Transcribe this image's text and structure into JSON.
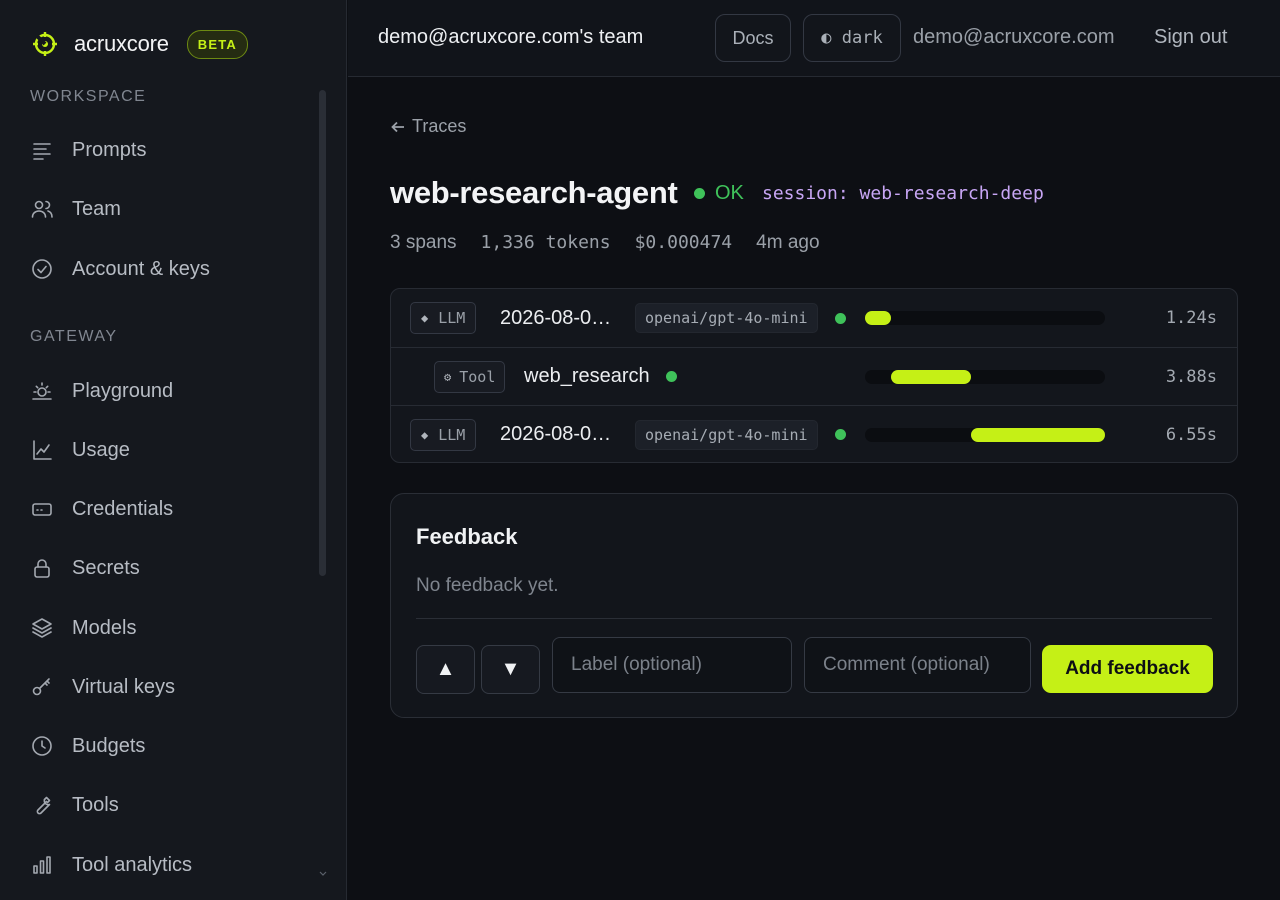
{
  "brand": {
    "name": "acruxcore",
    "badge": "BETA"
  },
  "sidebar": {
    "sections": [
      {
        "label": "WORKSPACE",
        "items": [
          {
            "label": "Prompts",
            "icon": "lines-icon"
          },
          {
            "label": "Team",
            "icon": "users-icon"
          },
          {
            "label": "Account & keys",
            "icon": "check-circle-icon"
          }
        ]
      },
      {
        "label": "GATEWAY",
        "items": [
          {
            "label": "Playground",
            "icon": "sun-icon"
          },
          {
            "label": "Usage",
            "icon": "line-chart-icon"
          },
          {
            "label": "Credentials",
            "icon": "card-icon"
          },
          {
            "label": "Secrets",
            "icon": "lock-icon"
          },
          {
            "label": "Models",
            "icon": "layers-icon"
          },
          {
            "label": "Virtual keys",
            "icon": "key-icon"
          },
          {
            "label": "Budgets",
            "icon": "clock-icon"
          },
          {
            "label": "Tools",
            "icon": "wrench-icon"
          },
          {
            "label": "Tool analytics",
            "icon": "bar-chart-icon"
          }
        ]
      }
    ]
  },
  "header": {
    "team": "demo@acruxcore.com's team",
    "docs": "Docs",
    "theme": "◐ dark",
    "email": "demo@acruxcore.com",
    "signout": "Sign out"
  },
  "trace": {
    "back": "Traces",
    "name": "web-research-agent",
    "status": "OK",
    "session_key": "session:",
    "session_value": "web-research-deep",
    "spans_count": "3 spans",
    "tokens": "1,336 tokens",
    "cost": "$0.000474",
    "age": "4m ago",
    "spans": [
      {
        "kind": "LLM",
        "kind_glyph": "◆",
        "name": "2026-08-0…",
        "model": "openai/gpt-4o-mini",
        "duration": "1.24s",
        "start_frac": 0.0,
        "width_frac": 0.11
      },
      {
        "kind": "Tool",
        "kind_glyph": "⚙",
        "name": "web_research",
        "model": "",
        "duration": "3.88s",
        "start_frac": 0.11,
        "width_frac": 0.33
      },
      {
        "kind": "LLM",
        "kind_glyph": "◆",
        "name": "2026-08-0…",
        "model": "openai/gpt-4o-mini",
        "duration": "6.55s",
        "start_frac": 0.44,
        "width_frac": 0.56
      }
    ]
  },
  "feedback": {
    "title": "Feedback",
    "empty": "No feedback yet.",
    "up": "▲",
    "down": "▼",
    "label_placeholder": "Label (optional)",
    "comment_placeholder": "Comment (optional)",
    "submit": "Add feedback"
  },
  "colors": {
    "accent": "#c5f016",
    "ok": "#3fc25a",
    "session": "#c8a6f5"
  }
}
